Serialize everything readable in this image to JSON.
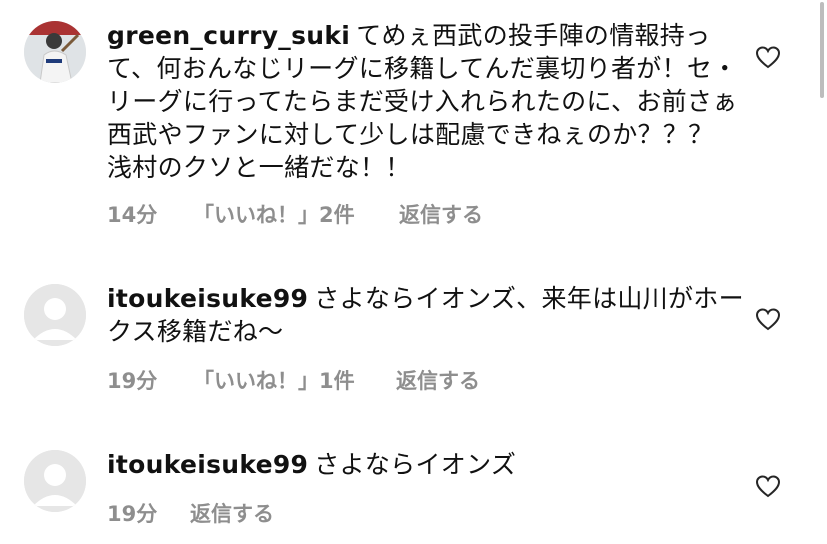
{
  "comments": [
    {
      "username": "green_curry_suki",
      "text": "てめぇ西武の投手陣の情報持って、何おんなじリーグに移籍してんだ裏切り者が！セ・リーグに行ってたらまだ受け入れられたのに、お前さぁ西武やファンに対して少しは配慮できねぇのか？？？　浅村のクソと一緒だな！！",
      "time": "14分",
      "likes": "「いいね！」2件",
      "reply_label": "返信する",
      "avatar_type": "photo"
    },
    {
      "username": "itoukeisuke99",
      "text": "さよならイオンズ、来年は山川がホークス移籍だね〜",
      "time": "19分",
      "likes": "「いいね！」1件",
      "reply_label": "返信する",
      "avatar_type": "default"
    },
    {
      "username": "itoukeisuke99",
      "text": "さよならイオンズ",
      "time": "19分",
      "likes": "",
      "reply_label": "返信する",
      "avatar_type": "default"
    }
  ],
  "icons": {
    "like": "heart-outline-icon",
    "avatar_default": "default-avatar-icon"
  },
  "colors": {
    "meta_text": "#8e8e8e",
    "avatar_bg": "#e6e6e6"
  }
}
